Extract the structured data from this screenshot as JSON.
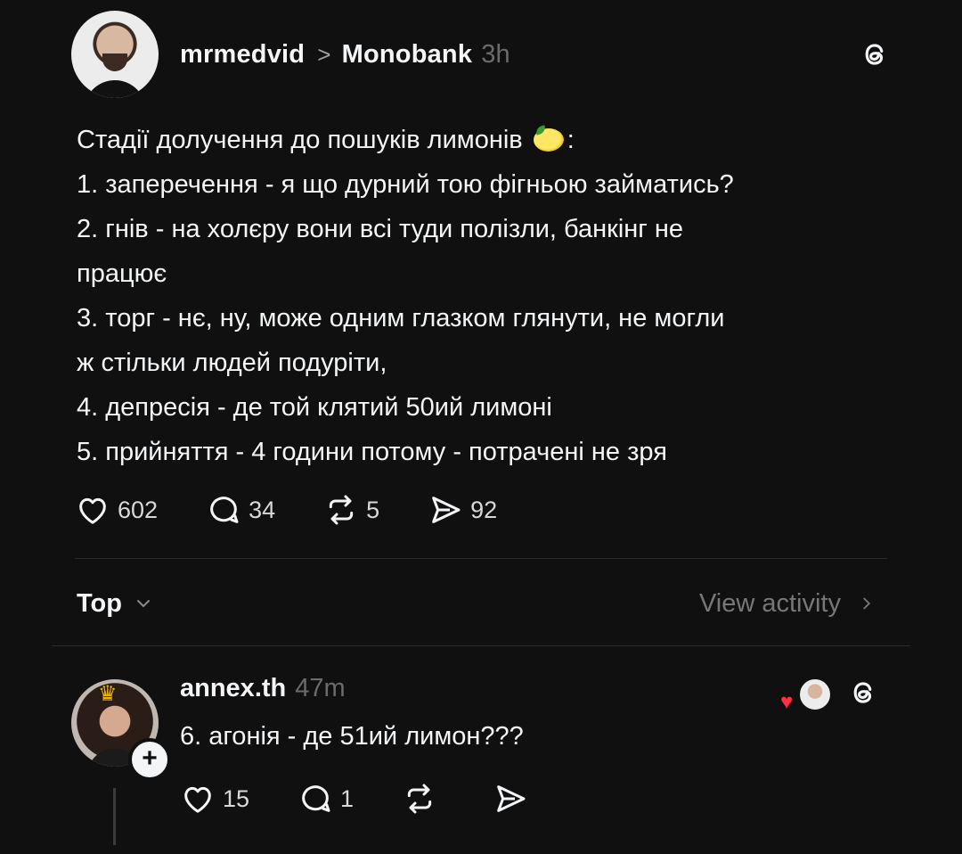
{
  "post": {
    "username": "mrmedvid",
    "separator": ">",
    "community": "Monobank",
    "time": "3h",
    "lines": [
      "Стадії долучення до пошуків лимонів",
      "1. заперечення - я що дурний тою фігньою займатись?",
      "2. гнів - на холєру вони всі туди полізли, банкінг не",
      "працює",
      "3. торг - нє, ну, може одним глазком глянути, не могли",
      "ж стільки людей подуріти,",
      "4. депресія - де той клятий 50ий лимоні",
      "5. прийняття - 4 години потому - потрачені не зря"
    ],
    "line1_suffix": ":",
    "actions": {
      "likes": "602",
      "comments": "34",
      "reposts": "5",
      "shares": "92"
    }
  },
  "sort": {
    "label": "Top",
    "view_activity": "View activity"
  },
  "reply": {
    "username": "annex.th",
    "time": "47m",
    "text": "6. агонія - де 51ий лимон???",
    "actions": {
      "likes": "15",
      "comments": "1"
    }
  },
  "icons": {
    "threads": "threads-logo-icon",
    "heart": "heart-icon",
    "comment": "comment-icon",
    "repost": "repost-icon",
    "share": "share-icon",
    "lemon": "lemon-emoji-icon",
    "crown": "crown-emoji-icon"
  },
  "colors": {
    "background": "#101010",
    "text": "#f3f5f7",
    "muted": "#6b6b6b",
    "like_red": "#ff3040"
  }
}
